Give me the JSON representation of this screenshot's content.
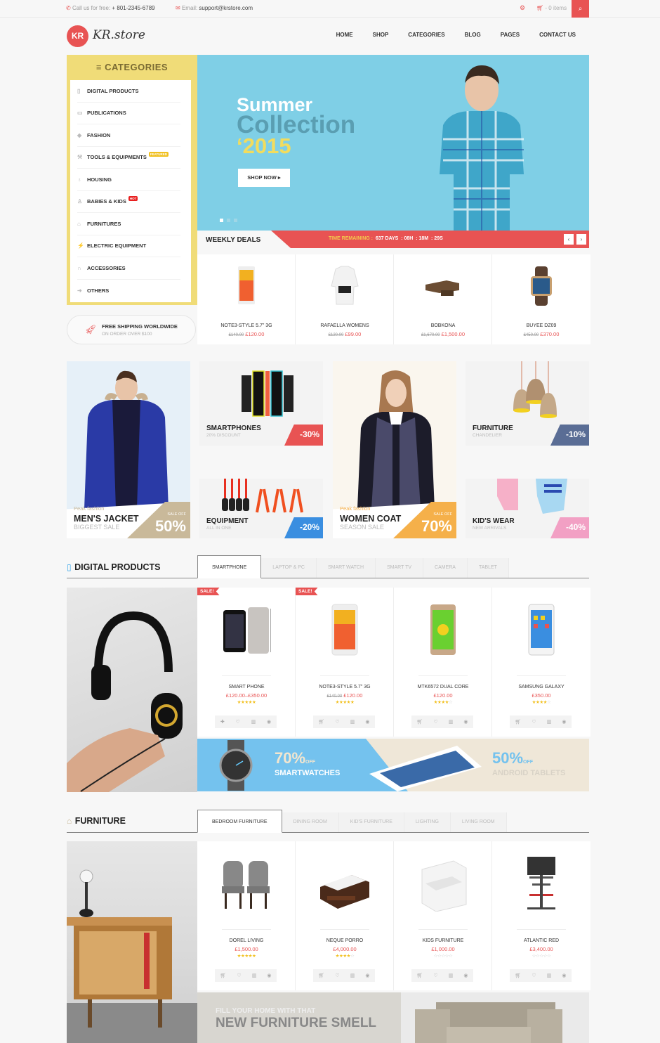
{
  "topbar": {
    "call_label": "Call us for free:",
    "phone": "+ 801-2345-6789",
    "email_label": "Email:",
    "email": "support@krstore.com",
    "cart_text": "- 0 items"
  },
  "header": {
    "logo_mark": "KR",
    "logo_text": "KR.store",
    "nav": [
      "HOME",
      "SHOP",
      "CATEGORIES",
      "BLOG",
      "PAGES",
      "CONTACT US"
    ]
  },
  "categories": {
    "title": "CATEGORIES",
    "items": [
      {
        "label": "DIGITAL PRODUCTS",
        "icon": "mobile-icon"
      },
      {
        "label": "PUBLICATIONS",
        "icon": "folder-icon"
      },
      {
        "label": "FASHION",
        "icon": "tag-icon"
      },
      {
        "label": "TOOLS & EQUIPMENTS",
        "icon": "wrench-icon",
        "badge": "FEATURED"
      },
      {
        "label": "HOUSING",
        "icon": "lightbulb-icon"
      },
      {
        "label": "BABIES & KIDS",
        "icon": "child-icon",
        "badge": "HOT"
      },
      {
        "label": "FURNITURES",
        "icon": "home-icon"
      },
      {
        "label": "ELECTRIC EQUIPMENT",
        "icon": "plug-icon"
      },
      {
        "label": "ACCESSORIES",
        "icon": "headphones-icon"
      },
      {
        "label": "OTHERS",
        "icon": "arrow-right-icon"
      }
    ]
  },
  "shipping": {
    "title": "FREE SHIPPING WORLDWIDE",
    "subtitle": "ON ORDER OVER $100"
  },
  "hero": {
    "line1": "Summer",
    "line2": "Collection",
    "line3": "‘2015",
    "cta": "SHOP NOW ▸",
    "slides": 3,
    "active_slide": 1
  },
  "weekly_deals": {
    "title": "WEEKLY DEALS",
    "timer_label": "TIME REMAINING :",
    "days": "637 DAYS",
    "hours": "08H",
    "minutes": "18M",
    "seconds": "29S",
    "prev": "‹",
    "next": "›",
    "items": [
      {
        "name": "NOTE3-STYLE 5.7\" 3G",
        "old_price": "£140.00",
        "price": "£120.00"
      },
      {
        "name": "RAFAELLA WOMENS",
        "old_price": "£120.00",
        "price": "£99.00"
      },
      {
        "name": "BOBKONA",
        "old_price": "£1,670.00",
        "price": "£1,500.00"
      },
      {
        "name": "BUYEE DZ09",
        "old_price": "£450.00",
        "price": "£370.00"
      }
    ]
  },
  "promos": {
    "mens_jacket": {
      "kicker": "Peak fashion",
      "title": "MEN'S JACKET",
      "subtitle": "BIGGEST SALE",
      "sale_label": "SALE OFF",
      "percent": "50%"
    },
    "smartphones": {
      "title": "SMARTPHONES",
      "subtitle": "20% DISCOUNT",
      "discount": "-30%"
    },
    "equipment": {
      "title": "EQUIPMENT",
      "subtitle": "ALL IN ONE",
      "discount": "-20%"
    },
    "women_coat": {
      "kicker": "Peak fashion",
      "title": "WOMEN COAT",
      "subtitle": "SEASON SALE",
      "sale_label": "SALE OFF",
      "percent": "70%"
    },
    "furniture": {
      "title": "FURNITURE",
      "subtitle": "CHANDELIER",
      "discount": "-10%"
    },
    "kids_wear": {
      "title": "KID'S WEAR",
      "subtitle": "NEW ARRIVALS",
      "discount": "-40%"
    }
  },
  "digital": {
    "title": "DIGITAL PRODUCTS",
    "tabs": [
      "SMARTPHONE",
      "LAPTOP & PC",
      "SMART WATCH",
      "SMART TV",
      "CAMERA",
      "TABLET"
    ],
    "active_tab": 0,
    "sale_label": "SALE!",
    "products": [
      {
        "name": "SMART PHONE",
        "old_price": "",
        "price": "£120.00–£350.00",
        "rating": 5,
        "sale": true
      },
      {
        "name": "NOTE3-STYLE 5.7\" 3G",
        "old_price": "£140.00",
        "price": "£120.00",
        "rating": 5,
        "sale": true
      },
      {
        "name": "MTK6572 DUAL CORE",
        "old_price": "",
        "price": "£120.00",
        "rating": 4,
        "sale": false
      },
      {
        "name": "SAMSUNG GALAXY",
        "old_price": "",
        "price": "£350.00",
        "rating": 4,
        "sale": false
      }
    ],
    "banner": {
      "left_percent": "70%",
      "left_off": "OFF",
      "left_label": "SMARTWATCHES",
      "right_percent": "50%",
      "right_off": "OFF",
      "right_label": "ANDROID TABLETS"
    }
  },
  "furniture": {
    "title": "FURNITURE",
    "tabs": [
      "BEDROOM FURNITURE",
      "DINING ROOM",
      "KID'S FURNITURE",
      "LIGHTING",
      "LIVING ROOM"
    ],
    "active_tab": 0,
    "products": [
      {
        "name": "DOREL LIVING",
        "price": "£1,500.00",
        "rating": 5
      },
      {
        "name": "NEQUE PORRO",
        "price": "£4,000.00",
        "rating": 4
      },
      {
        "name": "KIDS FURNITURE",
        "price": "£1,000.00",
        "rating": 0
      },
      {
        "name": "ATLANTIC RED",
        "price": "£3,400.00",
        "rating": 0
      }
    ],
    "banner": {
      "line1": "FILL YOUR HOME WITH THAT",
      "line2": "NEW FURNITURE SMELL"
    }
  },
  "colors": {
    "accent": "#e85353",
    "category_yellow": "#f0dc78",
    "hero_blue": "#7fcfe6",
    "star": "#f2c020"
  }
}
